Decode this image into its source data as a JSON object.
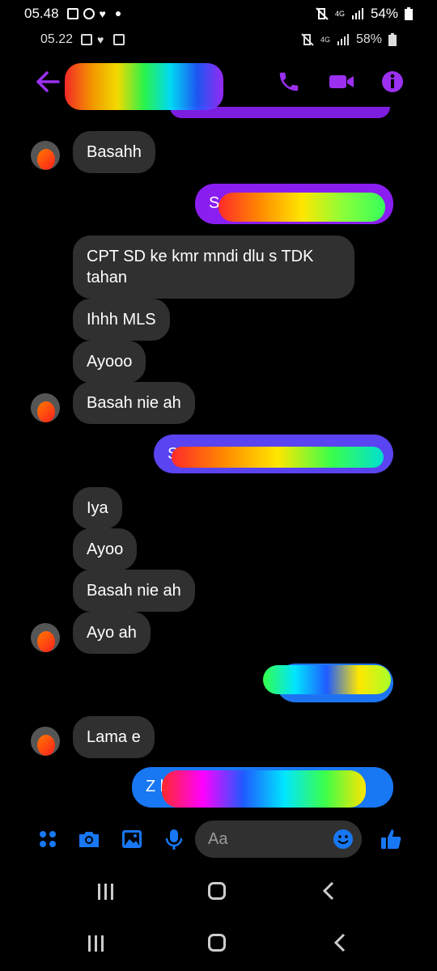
{
  "status_bar_1": {
    "time": "05.48",
    "battery": "54%",
    "network": "4G"
  },
  "status_bar_2": {
    "time": "05.22",
    "battery": "58%",
    "network": "4G"
  },
  "colors": {
    "accent": "#8a1ef0",
    "bubble_in": "#303030",
    "messenger_blue": "#1877f2"
  },
  "messages": [
    {
      "side": "in",
      "text": "Basahh"
    },
    {
      "side": "out",
      "text": "Su"
    },
    {
      "side": "in",
      "text": "CPT SD ke kmr mndi dlu s TDK tahan"
    },
    {
      "side": "in",
      "text": "Ihhh MLS"
    },
    {
      "side": "in",
      "text": "Ayooo"
    },
    {
      "side": "in",
      "text": "Basah nie ah"
    },
    {
      "side": "out",
      "text": "S"
    },
    {
      "side": "in",
      "text": "Iya"
    },
    {
      "side": "in",
      "text": "Ayoo"
    },
    {
      "side": "in",
      "text": "Basah nie ah"
    },
    {
      "side": "in",
      "text": "Ayo ah"
    },
    {
      "side": "out",
      "text": ""
    },
    {
      "side": "in",
      "text": "Lama e"
    },
    {
      "side": "out",
      "text": "Z k"
    }
  ],
  "composer": {
    "placeholder": "Aa"
  },
  "icons": {
    "header": [
      "back-arrow-icon",
      "phone-icon",
      "video-camera-icon",
      "info-icon"
    ],
    "composer": [
      "menu-dots-icon",
      "camera-icon",
      "image-icon",
      "microphone-icon",
      "emoji-icon",
      "thumbs-up-icon"
    ]
  }
}
